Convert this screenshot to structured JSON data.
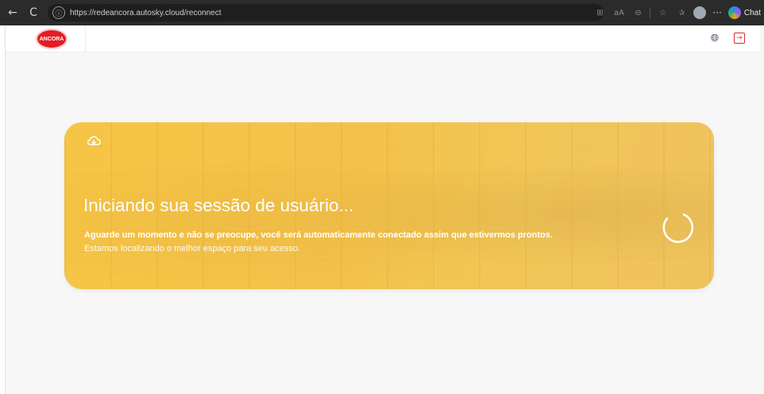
{
  "browser": {
    "back_glyph": "←",
    "reload_glyph": "C",
    "url": "https://redeancora.autosky.cloud/reconnect",
    "chat_label": "Chat",
    "more_glyph": "···"
  },
  "header": {
    "brand_text": "ANCORA"
  },
  "card": {
    "title": "Iniciando sua sessão de usuário...",
    "message_primary": "Aguarde um momento e não se preocupe, você será automaticamente conectado assim que estivermos prontos.",
    "message_secondary": "Estamos localizando o melhor espaço para seu acesso."
  },
  "colors": {
    "card_yellow": "#f4c24a",
    "brand_red": "#e31e24",
    "logout_red": "#d32f2f",
    "globe_navy": "#24374b"
  },
  "icons": {
    "back": "back-arrow-icon",
    "reload": "reload-icon",
    "site_info": "site-info-icon",
    "globe": "globe-icon",
    "logout": "logout-icon",
    "cloud": "cloud-sync-icon",
    "spinner": "loading-spinner-icon"
  }
}
